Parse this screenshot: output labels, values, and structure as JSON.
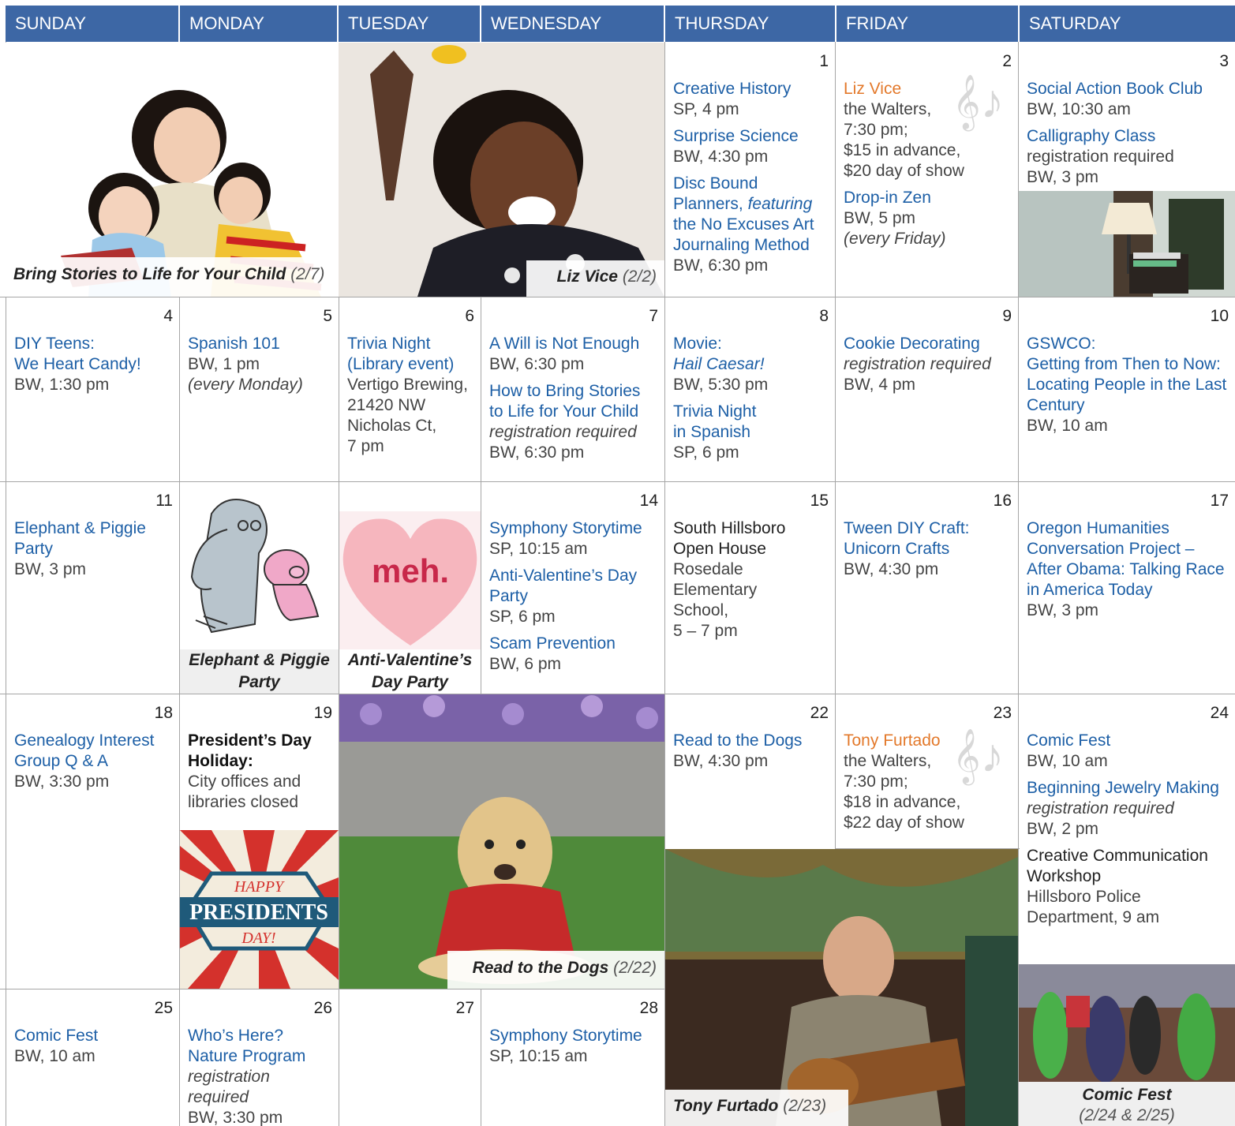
{
  "days": [
    "SUNDAY",
    "MONDAY",
    "TUESDAY",
    "WEDNESDAY",
    "THURSDAY",
    "FRIDAY",
    "SATURDAY"
  ],
  "captions": {
    "bring_stories": {
      "title": "Bring Stories to Life for Your Child",
      "date": "(2/7)"
    },
    "liz_vice": {
      "title": "Liz Vice",
      "date": "(2/2)"
    },
    "elephant": {
      "title": "Elephant & Piggie Party"
    },
    "anti_valentine": {
      "title": "Anti-Valentine’s Day Party"
    },
    "read_dogs": {
      "title": "Read to the Dogs",
      "date": "(2/22)"
    },
    "tony": {
      "title": "Tony Furtado",
      "date": "(2/23)"
    },
    "comic_fest": {
      "title": "Comic Fest",
      "date": "(2/24 & 2/25)"
    }
  },
  "art_text": {
    "meh": "meh.",
    "happy": "HAPPY",
    "presidents": "PRESIDENTS",
    "day": "DAY!"
  },
  "cells": {
    "d1": {
      "num": "1",
      "e": [
        {
          "t": "Creative History",
          "d": "SP, 4 pm"
        },
        {
          "t": "Surprise Science",
          "d": "BW, 4:30 pm"
        },
        {
          "t1": "Disc Bound Planners,",
          "t2": "featuring",
          "t3": "the No Excuses Art Journaling Method",
          "d": "BW, 6:30 pm"
        }
      ]
    },
    "d2": {
      "num": "2",
      "e": [
        {
          "t": "Liz Vice",
          "d1": "the Walters,",
          "d2": "7:30 pm;",
          "d3": "$15 in advance,",
          "d4": "$20 day of show"
        },
        {
          "t": "Drop-in Zen",
          "d": "BW, 5 pm",
          "n": "(every Friday)"
        }
      ]
    },
    "d3": {
      "num": "3",
      "e": [
        {
          "t": "Social Action Book Club",
          "d": "BW, 10:30 am"
        },
        {
          "t": "Calligraphy Class",
          "d1": "registration required",
          "d2": "BW, 3 pm"
        }
      ]
    },
    "d4": {
      "num": "4",
      "e": [
        {
          "t1": "DIY Teens:",
          "t2": "We Heart Candy!",
          "d": "BW, 1:30 pm"
        }
      ]
    },
    "d5": {
      "num": "5",
      "e": [
        {
          "t": "Spanish 101",
          "d": "BW, 1 pm",
          "n": "(every Monday)"
        }
      ]
    },
    "d6": {
      "num": "6",
      "e": [
        {
          "t1": "Trivia Night",
          "t2": "(Library event)",
          "d1": "Vertigo Brewing,",
          "d2": "21420 NW",
          "d3": "Nicholas Ct,",
          "d4": "7 pm"
        }
      ]
    },
    "d7": {
      "num": "7",
      "e": [
        {
          "t": "A Will is Not Enough",
          "d": "BW, 6:30 pm"
        },
        {
          "t": "How to Bring Stories to Life for Your Child",
          "n": "registration required",
          "d": "BW, 6:30 pm"
        }
      ]
    },
    "d8": {
      "num": "8",
      "e": [
        {
          "t1": "Movie:",
          "t2": "Hail Caesar!",
          "d": "BW, 5:30 pm"
        },
        {
          "t1": "Trivia Night",
          "t2": "in Spanish",
          "d": "SP, 6 pm"
        }
      ]
    },
    "d9": {
      "num": "9",
      "e": [
        {
          "t": "Cookie Decorating",
          "n": "registration required",
          "d": "BW, 4 pm"
        }
      ]
    },
    "d10": {
      "num": "10",
      "e": [
        {
          "t1": "GSWCO:",
          "t2": "Getting from Then to Now: Locating People in the Last Century",
          "d": "BW, 10 am"
        }
      ]
    },
    "d11": {
      "num": "11",
      "e": [
        {
          "t": "Elephant & Piggie Party",
          "d": "BW, 3 pm"
        }
      ]
    },
    "d14": {
      "num": "14",
      "e": [
        {
          "t": "Symphony Storytime",
          "d": "SP, 10:15 am"
        },
        {
          "t": "Anti-Valentine’s Day Party",
          "d": "SP, 6 pm"
        },
        {
          "t": "Scam Prevention",
          "d": "BW, 6 pm"
        }
      ]
    },
    "d15": {
      "num": "15",
      "e": [
        {
          "t": "South Hillsboro Open House",
          "d1": "Rosedale Elementary",
          "d2": "School,",
          "d3": "5 – 7 pm"
        }
      ]
    },
    "d16": {
      "num": "16",
      "e": [
        {
          "t1": "Tween DIY Craft:",
          "t2": "Unicorn Crafts",
          "d": "BW, 4:30 pm"
        }
      ]
    },
    "d17": {
      "num": "17",
      "e": [
        {
          "t": "Oregon Humanities Conversation Project – After Obama: Talking Race in America Today",
          "d": "BW, 3 pm"
        }
      ]
    },
    "d18": {
      "num": "18",
      "e": [
        {
          "t": "Genealogy Interest Group Q & A",
          "d": "BW, 3:30 pm"
        }
      ]
    },
    "d19": {
      "num": "19",
      "e": [
        {
          "t": "President’s Day Holiday:",
          "d": "City offices and libraries closed"
        }
      ]
    },
    "d22": {
      "num": "22",
      "e": [
        {
          "t": "Read to the Dogs",
          "d": "BW, 4:30 pm"
        }
      ]
    },
    "d23": {
      "num": "23",
      "e": [
        {
          "t": "Tony Furtado",
          "d1": "the Walters,",
          "d2": "7:30 pm;",
          "d3": "$18 in advance,",
          "d4": "$22 day of show"
        }
      ]
    },
    "d24": {
      "num": "24",
      "e": [
        {
          "t": "Comic Fest",
          "d": "BW, 10 am"
        },
        {
          "t": "Beginning Jewelry Making",
          "n": "registration required",
          "d": "BW, 2 pm"
        },
        {
          "t": "Creative Communication Workshop",
          "d": "Hillsboro Police Department, 9 am"
        }
      ]
    },
    "d25": {
      "num": "25",
      "e": [
        {
          "t": "Comic Fest",
          "d": "BW, 10 am"
        }
      ]
    },
    "d26": {
      "num": "26",
      "e": [
        {
          "t1": "Who’s Here?",
          "t2": "Nature Program",
          "n": "registration required",
          "d": "BW, 3:30 pm"
        }
      ]
    },
    "d27": {
      "num": "27"
    },
    "d28": {
      "num": "28",
      "e": [
        {
          "t": "Symphony Storytime",
          "d": "SP, 10:15 am"
        }
      ]
    }
  }
}
